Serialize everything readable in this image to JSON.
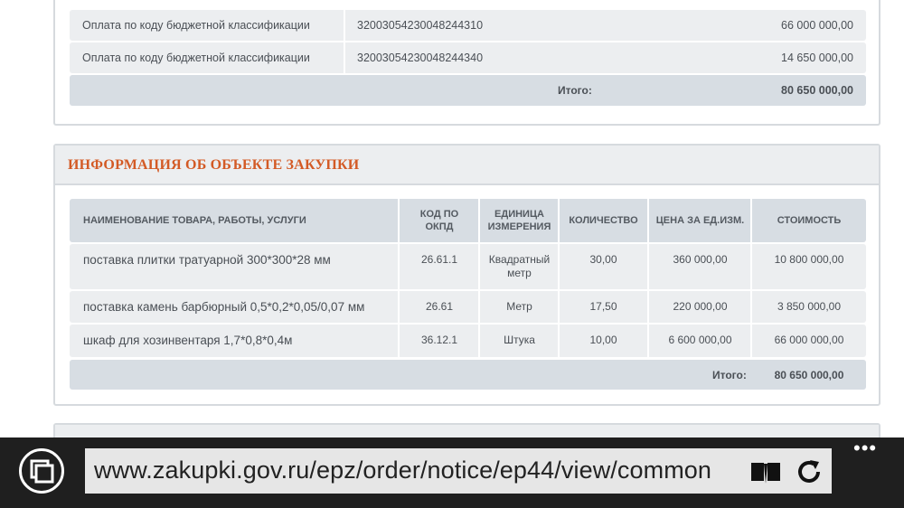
{
  "budget": {
    "rows": [
      {
        "label": "Оплата по коду бюджетной классификации",
        "code": "32003054230048244310",
        "amount": "66 000 000,00"
      },
      {
        "label": "Оплата по коду бюджетной классификации",
        "code": "32003054230048244340",
        "amount": "14 650 000,00"
      }
    ],
    "total_label": "Итого:",
    "total_value": "80 650 000,00"
  },
  "object": {
    "title": "ИНФОРМАЦИЯ ОБ ОБЪЕКТЕ ЗАКУПКИ",
    "headers": {
      "name": "НАИМЕНОВАНИЕ ТОВАРА, РАБОТЫ, УСЛУГИ",
      "okpd_1": "КОД ПО",
      "okpd_2": "ОКПД",
      "unit_1": "ЕДИНИЦА",
      "unit_2": "ИЗМЕРЕНИЯ",
      "qty": "КОЛИЧЕСТВО",
      "price": "ЦЕНА ЗА ЕД.ИЗМ.",
      "cost": "СТОИМОСТЬ"
    },
    "items": [
      {
        "name": "поставка плитки тратуарной 300*300*28 мм",
        "okpd": "26.61.1",
        "unit_1": "Квадратный",
        "unit_2": "метр",
        "qty": "30,00",
        "price": "360 000,00",
        "cost": "10 800 000,00"
      },
      {
        "name": "поставка камень барбюрный 0,5*0,2*0,05/0,07 мм",
        "okpd": "26.61",
        "unit_1": "Метр",
        "unit_2": "",
        "qty": "17,50",
        "price": "220 000,00",
        "cost": "3 850 000,00"
      },
      {
        "name": "шкаф для хозинвентаря 1,7*0,8*0,4м",
        "okpd": "36.12.1",
        "unit_1": "Штука",
        "unit_2": "",
        "qty": "10,00",
        "price": "6 600 000,00",
        "cost": "66 000 000,00"
      }
    ],
    "total_label": "Итого:",
    "total_value": "80 650 000,00"
  },
  "browser": {
    "url": "www.zakupki.gov.ru/epz/order/notice/ep44/view/common",
    "icons": [
      "tabs-icon",
      "reading-view-icon",
      "refresh-icon",
      "more-icon"
    ],
    "more_label": "•••"
  }
}
